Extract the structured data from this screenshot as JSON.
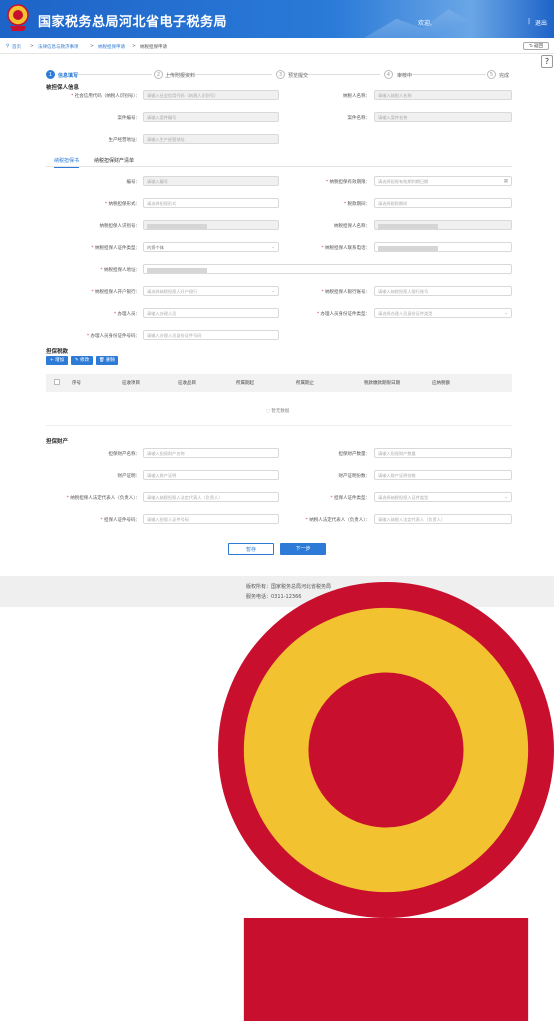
{
  "header": {
    "title": "国家税务总局河北省电子税务局",
    "welcome": "欢迎,",
    "separator": "|",
    "logout": "退出"
  },
  "breadcrumb": {
    "home": "首页",
    "sep": ">",
    "c1": "法律信息与救济事项",
    "c2": "纳税担保申请",
    "c3": "纳税担保申请",
    "back": "返回"
  },
  "steps": [
    "信息填写",
    "上传附报资料",
    "预览提交",
    "审核中",
    "完成"
  ],
  "sections": {
    "guarantor_info": "被担保人信息",
    "guarantee_tax": "担保税款",
    "guarantee_property": "担保财产"
  },
  "top_fields": {
    "credit_code": {
      "label": "社会信用代码（纳税人识别号）：",
      "ph": "请输入社会信用代码（纳税人识别号）"
    },
    "taxpayer_name": {
      "label": "纳税人名称：",
      "ph": "请输入纳税人名称"
    },
    "case_no": {
      "label": "案件编号：",
      "ph": "请输入案件编号"
    },
    "case_name": {
      "label": "案件名称：",
      "ph": "请输入案件名称"
    },
    "address": {
      "label": "生产经营地址：",
      "ph": "请输入生产经营地址"
    }
  },
  "tabs": [
    "纳税担保书",
    "纳税担保财产清单"
  ],
  "form": {
    "number": {
      "label": "编号：",
      "ph": "请输入编号"
    },
    "deadline": {
      "label": "纳税担保有效期限：",
      "ph": "请选择担保有效期到期日期"
    },
    "form_type": {
      "label": "纳税担保形式：",
      "ph": "请选择担保形式"
    },
    "tax_period": {
      "label": "税款期间：",
      "ph": "请选择税款期间"
    },
    "guarantor_id": {
      "label": "纳税担保人识别号："
    },
    "guarantor_name": {
      "label": "纳税担保人名称："
    },
    "reg_type": {
      "label": "纳税担保人证件类型：",
      "value": "内资个体"
    },
    "contact": {
      "label": "纳税担保人联系电话："
    },
    "guarantor_addr": {
      "label": "纳税担保人地址："
    },
    "bank": {
      "label": "纳税担保人开户银行：",
      "ph": "请选择纳税担保人开户银行"
    },
    "account": {
      "label": "纳税担保人银行账号：",
      "ph": "请输入纳税担保人银行账号"
    },
    "handler": {
      "label": "办理人员：",
      "ph": "请输入办理人员"
    },
    "handler_idtype": {
      "label": "办理人员身份证件类型：",
      "ph": "请选择办理人员身份证件类型"
    },
    "handler_idno": {
      "label": "办理人员身份证件号码：",
      "ph": "请输入办理人员身份证件号码"
    }
  },
  "table": {
    "buttons": [
      "+ 增加",
      "✎ 修改",
      "🗑 删除"
    ],
    "headers": [
      "序号",
      "征收项目",
      "征收品目",
      "所属期起",
      "所属期止",
      "税款缴款期限日期",
      "应纳税额"
    ],
    "empty": "暂无数据"
  },
  "property": {
    "name": {
      "label": "担保财产名称：",
      "ph": "请输入担保财产名称"
    },
    "qty": {
      "label": "担保财产数量：",
      "ph": "请输入担保财产数量"
    },
    "cert": {
      "label": "财产证明：",
      "ph": "请输入财产证明"
    },
    "cert_count": {
      "label": "财产证明份数：",
      "ph": "请输入财产证明份数"
    },
    "legal_rep": {
      "label": "纳税担保人法定代表人（负责人）：",
      "ph": "请输入纳税担保人法定代表人（负责人）"
    },
    "id_type": {
      "label": "担保人证件类型：",
      "ph": "请选择纳税担保人证件类型"
    },
    "id_no": {
      "label": "担保人证件号码：",
      "ph": "请输入担保人证件号码"
    },
    "taxpayer_rep": {
      "label": "纳税人法定代表人（负责人）：",
      "ph": "请输入纳税人法定代表人（负责人）"
    }
  },
  "actions": {
    "save": "暂存",
    "next": "下一步"
  },
  "footer": {
    "copyright": "版权所有：国家税务总局河北省税务局",
    "hotline": "服务电话：0311-12366"
  }
}
